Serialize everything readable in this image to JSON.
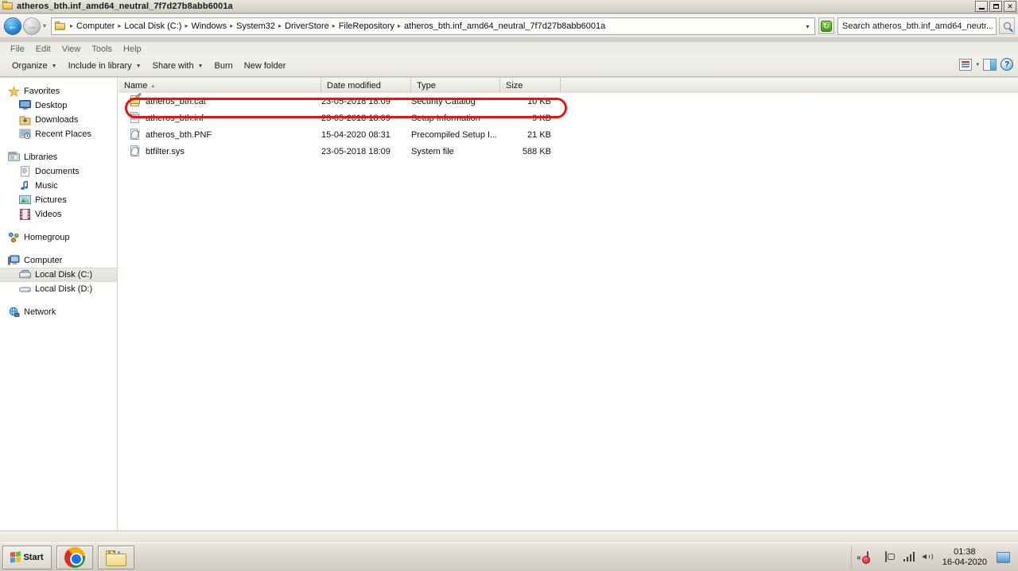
{
  "window": {
    "title": "atheros_bth.inf_amd64_neutral_7f7d27b8abb6001a",
    "icon": "folder-icon",
    "minimize_label": "_",
    "restore_label": "❐",
    "close_label": "✕"
  },
  "address_bar": {
    "back_label": "←",
    "forward_label": "→",
    "history_label": "▾",
    "dropdown_label": "▾",
    "refresh_label": "⟳",
    "breadcrumbs": [
      "Computer",
      "Local Disk (C:)",
      "Windows",
      "System32",
      "DriverStore",
      "FileRepository",
      "atheros_bth.inf_amd64_neutral_7f7d27b8abb6001a"
    ],
    "separator": "▸",
    "search_value": "Search atheros_bth.inf_amd64_neutr...",
    "search_placeholder": "Search atheros_bth.inf_amd64_neutr..."
  },
  "menu_bar": {
    "items": [
      "File",
      "Edit",
      "View",
      "Tools",
      "Help"
    ]
  },
  "command_bar": {
    "items": [
      {
        "label": "Organize",
        "has_caret": true
      },
      {
        "label": "Include in library",
        "has_caret": true
      },
      {
        "label": "Share with",
        "has_caret": true
      },
      {
        "label": "Burn",
        "has_caret": false
      },
      {
        "label": "New folder",
        "has_caret": false
      }
    ],
    "view_caret": "▾",
    "help_label": "?"
  },
  "nav_pane": {
    "groups": [
      {
        "header": {
          "label": "Favorites",
          "icon": "star-icon"
        },
        "items": [
          {
            "label": "Desktop",
            "icon": "desktop-icon"
          },
          {
            "label": "Downloads",
            "icon": "downloads-icon"
          },
          {
            "label": "Recent Places",
            "icon": "recent-places-icon"
          }
        ]
      },
      {
        "header": {
          "label": "Libraries",
          "icon": "libraries-icon"
        },
        "items": [
          {
            "label": "Documents",
            "icon": "documents-icon"
          },
          {
            "label": "Music",
            "icon": "music-icon"
          },
          {
            "label": "Pictures",
            "icon": "pictures-icon"
          },
          {
            "label": "Videos",
            "icon": "videos-icon"
          }
        ]
      },
      {
        "header": {
          "label": "Homegroup",
          "icon": "homegroup-icon"
        },
        "items": []
      },
      {
        "header": {
          "label": "Computer",
          "icon": "computer-icon"
        },
        "items": [
          {
            "label": "Local Disk (C:)",
            "icon": "hard-drive-icon",
            "selected": true
          },
          {
            "label": "Local Disk (D:)",
            "icon": "disk-drive-icon",
            "selected": false
          }
        ]
      },
      {
        "header": {
          "label": "Network",
          "icon": "network-icon"
        },
        "items": []
      }
    ]
  },
  "file_list": {
    "columns": [
      {
        "label": "Name",
        "sort": "▴"
      },
      {
        "label": "Date modified",
        "sort": ""
      },
      {
        "label": "Type",
        "sort": ""
      },
      {
        "label": "Size",
        "sort": ""
      }
    ],
    "rows": [
      {
        "name": "atheros_bth.cat",
        "date_modified": "23-05-2018 18:09",
        "type": "Security Catalog",
        "size": "10 KB",
        "icon": "security-catalog-icon",
        "highlighted": true
      },
      {
        "name": "atheros_bth.inf",
        "date_modified": "23-05-2018 18:09",
        "type": "Setup Information",
        "size": "9 KB",
        "icon": "setup-information-icon",
        "highlighted": false
      },
      {
        "name": "atheros_bth.PNF",
        "date_modified": "15-04-2020 08:31",
        "type": "Precompiled Setup I...",
        "size": "21 KB",
        "icon": "precompiled-setup-icon",
        "highlighted": false
      },
      {
        "name": "btfilter.sys",
        "date_modified": "23-05-2018 18:09",
        "type": "System file",
        "size": "588 KB",
        "icon": "system-file-icon",
        "highlighted": false
      }
    ]
  },
  "annotation": {
    "color": "#ee1111",
    "shape": "rounded-rectangle",
    "target": "atheros_bth.cat"
  },
  "taskbar": {
    "start_label": "Start",
    "buttons": [
      {
        "label": "",
        "icon": "chrome-icon"
      },
      {
        "label": "",
        "icon": "windows-explorer-icon"
      }
    ],
    "tray": {
      "expand_label": "«",
      "icons": [
        "action-center-flag-icon",
        "safely-remove-hardware-icon",
        "network-signal-icon",
        "volume-icon"
      ],
      "time": "01:38",
      "date": "16-04-2020"
    }
  }
}
